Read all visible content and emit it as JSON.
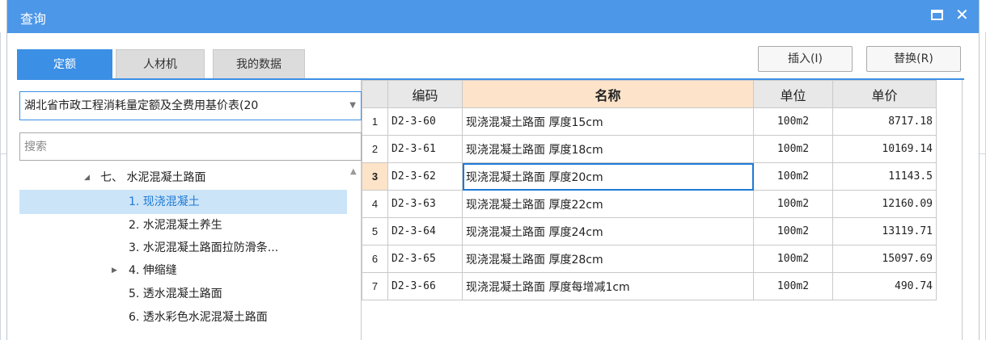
{
  "window": {
    "title": "查询"
  },
  "tabs": [
    {
      "label": "定额",
      "active": true
    },
    {
      "label": "人材机",
      "active": false
    },
    {
      "label": "我的数据",
      "active": false
    }
  ],
  "toolbar": {
    "insert_label": "插入(I)",
    "replace_label": "替换(R)"
  },
  "library": {
    "selected": "湖北省市政工程消耗量定额及全费用基价表(20"
  },
  "search": {
    "placeholder": "搜索",
    "value": ""
  },
  "tree": [
    {
      "label": "七、 水泥混凝土路面",
      "expanded": true,
      "selected": false
    },
    {
      "label": "1. 现浇混凝土",
      "selected": true
    },
    {
      "label": "2. 水泥混凝土养生",
      "selected": false
    },
    {
      "label": "3. 水泥混凝土路面拉防滑条...",
      "selected": false
    },
    {
      "label": "4. 伸缩缝",
      "expanded": false,
      "selected": false
    },
    {
      "label": "5. 透水混凝土路面",
      "selected": false
    },
    {
      "label": "6. 透水彩色水泥混凝土路面",
      "selected": false
    }
  ],
  "grid": {
    "columns": {
      "code": "编码",
      "name": "名称",
      "unit": "单位",
      "price": "单价"
    },
    "rows": [
      {
        "idx": "1",
        "code": "D2-3-60",
        "name": "现浇混凝土路面 厚度15cm",
        "unit": "100m2",
        "price": "8717.18"
      },
      {
        "idx": "2",
        "code": "D2-3-61",
        "name": "现浇混凝土路面 厚度18cm",
        "unit": "100m2",
        "price": "10169.14"
      },
      {
        "idx": "3",
        "code": "D2-3-62",
        "name": "现浇混凝土路面 厚度20cm",
        "unit": "100m2",
        "price": "11143.5"
      },
      {
        "idx": "4",
        "code": "D2-3-63",
        "name": "现浇混凝土路面 厚度22cm",
        "unit": "100m2",
        "price": "12160.09"
      },
      {
        "idx": "5",
        "code": "D2-3-64",
        "name": "现浇混凝土路面 厚度24cm",
        "unit": "100m2",
        "price": "13119.71"
      },
      {
        "idx": "6",
        "code": "D2-3-65",
        "name": "现浇混凝土路面 厚度28cm",
        "unit": "100m2",
        "price": "15097.69"
      },
      {
        "idx": "7",
        "code": "D2-3-66",
        "name": "现浇混凝土路面 厚度每增减1cm",
        "unit": "100m2",
        "price": "490.74"
      }
    ],
    "selected_row": 3
  },
  "colors": {
    "titlebar": "#4c97e8",
    "accent": "#3b8fe5",
    "selection": "#cce4f7",
    "header_highlight": "#fce3c9"
  }
}
